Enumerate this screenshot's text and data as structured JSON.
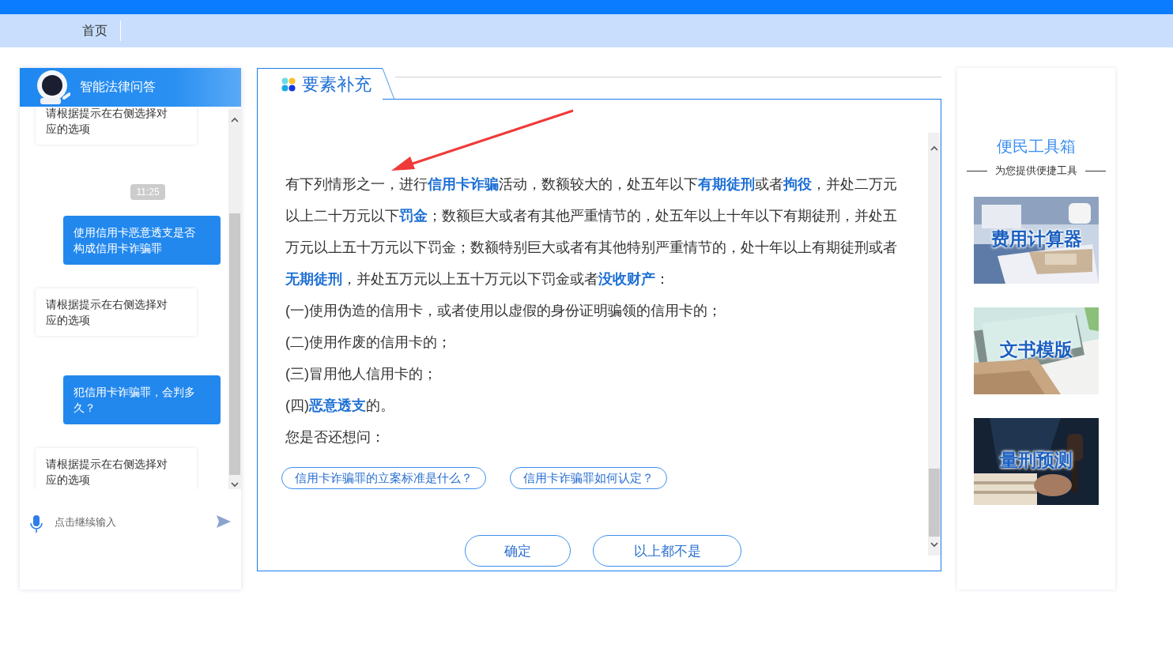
{
  "nav": {
    "items": [
      {
        "label": "首页",
        "selected": true
      }
    ]
  },
  "chat": {
    "title": "智能法律问答",
    "messages": [
      {
        "kind": "bot",
        "text": "请根据提示在右侧选择对应的选项"
      },
      {
        "kind": "time",
        "text": "11:25"
      },
      {
        "kind": "user",
        "text": "使用信用卡恶意透支是否构成信用卡诈骗罪"
      },
      {
        "kind": "bot",
        "text": "请根据提示在右侧选择对应的选项"
      },
      {
        "kind": "user",
        "text": "犯信用卡诈骗罪，会判多久？"
      },
      {
        "kind": "bot",
        "text": "请根据提示在右侧选择对应的选项"
      }
    ],
    "input": {
      "placeholder": "点击继续输入"
    }
  },
  "panel": {
    "tab": "要素补充",
    "paragraphs": [
      "有下列情形之一，进行**信用卡诈骗**活动，数额较大的，处五年以下**有期徒刑**或者**拘役**，并处二万元以上二十万元以下**罚金**；数额巨大或者有其他严重情节的，处五年以上十年以下有期徒刑，并处五万元以上五十万元以下罚金；数额特别巨大或者有其他特别严重情节的，处十年以上有期徒刑或者**无期徒刑**，并处五万元以上五十万元以下罚金或者**没收财产**：",
      "(一)使用伪造的信用卡，或者使用以虚假的身份证明骗领的信用卡的；",
      "(二)使用作废的信用卡的；",
      "(三)冒用他人信用卡的；",
      "(四)**恶意透支**的。",
      "您是否还想问："
    ],
    "suggestions": [
      "信用卡诈骗罪的立案标准是什么？",
      "信用卡诈骗罪如何认定？"
    ],
    "buttons": [
      "确定",
      "以上都不是"
    ]
  },
  "tools": {
    "title": "便民工具箱",
    "subtitle": "为您提供便捷工具",
    "items": [
      {
        "label": "费用计算器",
        "kind": "desk"
      },
      {
        "label": "文书模版",
        "kind": "documents"
      },
      {
        "label": "量刑预测",
        "kind": "gavel"
      }
    ]
  }
}
